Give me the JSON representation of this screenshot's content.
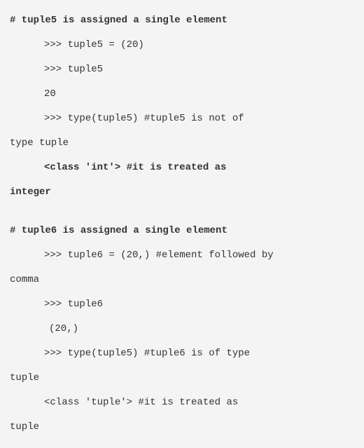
{
  "block1": {
    "comment": "# tuple5 is assigned a single element",
    "l1": ">>> tuple5 = (20)",
    "l2": ">>> tuple5",
    "l3": "20",
    "l4": ">>> type(tuple5)    #tuple5 is not of",
    "l4b": "type tuple",
    "l5": "<class 'int'>       #it is treated as",
    "l5b": "integer"
  },
  "block2": {
    "comment": "# tuple6 is assigned a single element",
    "l1": ">>> tuple6 = (20,) #element followed by",
    "l1b": "comma",
    "l2": ">>> tuple6",
    "l3": " (20,)",
    "l4": ">>> type(tuple5)   #tuple6 is of type",
    "l4b": "tuple",
    "l5": "<class 'tuple'>   #it is treated as",
    "l5b": "tuple"
  }
}
